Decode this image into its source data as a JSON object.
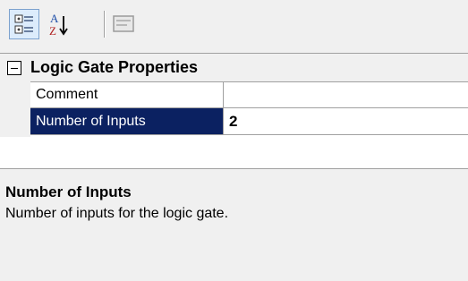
{
  "toolbar": {
    "categorized_icon": "categorized-view-icon",
    "alphabetical_icon": "sort-alphabetical-icon",
    "property_pages_icon": "property-pages-icon",
    "alpha_top": "A",
    "alpha_bottom": "Z"
  },
  "category": {
    "label": "Logic Gate Properties",
    "expanded": true
  },
  "properties": [
    {
      "name": "Comment",
      "value": ""
    },
    {
      "name": "Number of Inputs",
      "value": "2",
      "selected": true
    }
  ],
  "description": {
    "title": "Number of Inputs",
    "text": "Number of inputs for the logic gate."
  },
  "colors": {
    "selection": "#0b2161",
    "background": "#f0f0f0",
    "grid_line": "#a0a0a0"
  }
}
